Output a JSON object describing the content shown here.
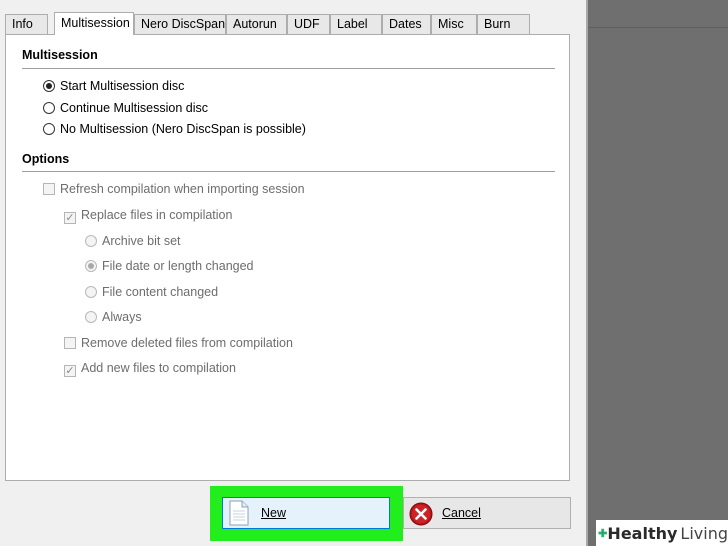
{
  "tabs": [
    {
      "label": "Info"
    },
    {
      "label": "Multisession"
    },
    {
      "label": "Nero DiscSpan"
    },
    {
      "label": "Autorun"
    },
    {
      "label": "UDF"
    },
    {
      "label": "Label"
    },
    {
      "label": "Dates"
    },
    {
      "label": "Misc"
    },
    {
      "label": "Burn"
    }
  ],
  "multisession": {
    "title": "Multisession",
    "options": [
      {
        "label": "Start Multisession disc",
        "selected": true
      },
      {
        "label": "Continue Multisession disc",
        "selected": false
      },
      {
        "label": "No Multisession (Nero DiscSpan is possible)",
        "selected": false
      }
    ]
  },
  "options": {
    "title": "Options",
    "refresh": "Refresh compilation when importing session",
    "replace": "Replace files in compilation",
    "archive_bit": "Archive bit set",
    "file_date": "File date or length changed",
    "file_content": "File content changed",
    "always": "Always",
    "remove_deleted": "Remove deleted files from compilation",
    "add_new": "Add new files to compilation"
  },
  "buttons": {
    "new": "New",
    "cancel": "Cancel"
  },
  "watermark": {
    "part1": "Healthy",
    "part2": "Living"
  },
  "colors": {
    "highlight": "#22ee1e",
    "cancel_red": "#b8161b"
  }
}
